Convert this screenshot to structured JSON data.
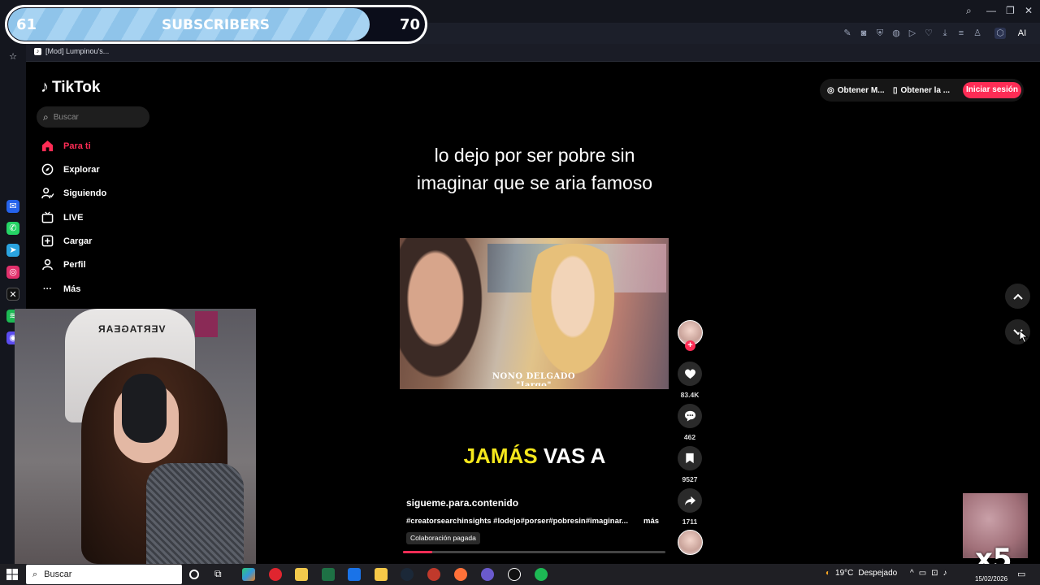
{
  "overlay": {
    "sub_current": "61",
    "sub_label": "SUBSCRIBERS",
    "sub_goal": "70",
    "progress": 0.87
  },
  "browser": {
    "bookmark_tab": "[Mod] Lumpinou's...",
    "ai_label": "AI"
  },
  "tiktok": {
    "logo": "TikTok",
    "search_placeholder": "Buscar",
    "nav": [
      "Para ti",
      "Explorar",
      "Siguiendo",
      "LIVE",
      "Cargar",
      "Perfil",
      "Más"
    ],
    "top_buttons": {
      "get_coins": "Obtener M...",
      "get_app": "Obtener la ...",
      "login": "Iniciar sesión"
    }
  },
  "video": {
    "caption": "lo dejo por ser pobre sin imaginar que se aria famoso",
    "watermark_line1": "NONO DELGADO",
    "watermark_line2": "\"Iargo\"",
    "subtitle_highlight": "JAMÁS",
    "subtitle_rest": "VAS A",
    "username": "sigueme.para.contenido",
    "hashtags": "#creatorsearchinsights #lodejo#porser#pobresin#imaginar...",
    "more": "más",
    "collab": "Colaboración pagada",
    "progress": 0.11
  },
  "actions": {
    "likes": "83.4K",
    "comments": "462",
    "saves": "9527",
    "shares": "1711"
  },
  "webcam": {
    "chair_text": "VERTAGEAR"
  },
  "corner": {
    "speed": "x5"
  },
  "taskbar": {
    "search": "Buscar",
    "temp": "19°C",
    "weather": "Despejado",
    "date": "15/02/2026"
  },
  "colors": {
    "tiktok_red": "#fe2c55",
    "highlight_yellow": "#f5e71c"
  }
}
